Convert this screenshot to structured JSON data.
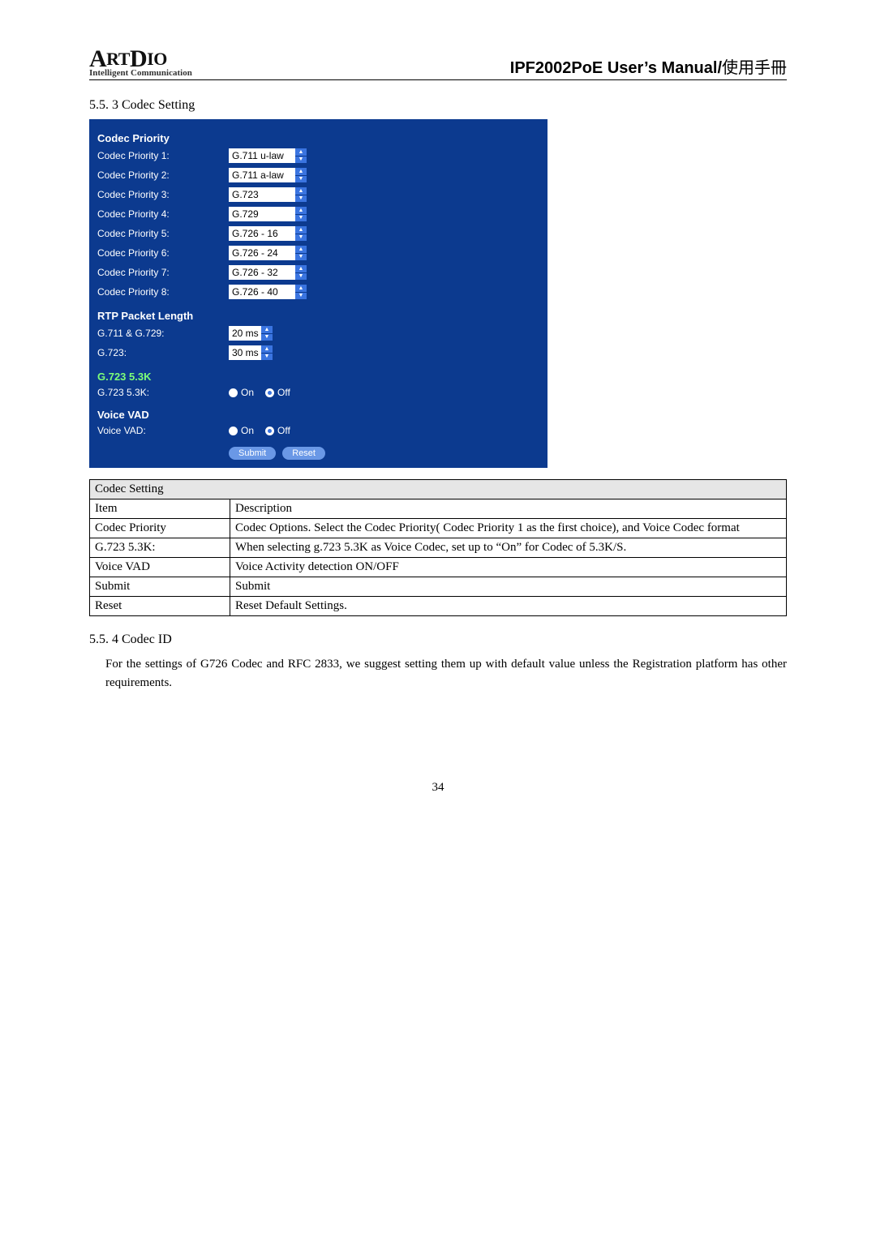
{
  "header": {
    "logo_top_a": "A",
    "logo_top_rt": "RT",
    "logo_top_d": "D",
    "logo_top_io": "IO",
    "logo_sub": "Intelligent Communication",
    "title_bold": "IPF2002PoE User’s Manual",
    "title_sep": "/",
    "title_cjk": "使用手冊"
  },
  "section_codec_setting": "5.5. 3 Codec Setting",
  "panel": {
    "codec_priority_title": "Codec Priority",
    "rows": [
      {
        "label": "Codec Priority 1:",
        "value": "G.711 u-law"
      },
      {
        "label": "Codec Priority 2:",
        "value": "G.711 a-law"
      },
      {
        "label": "Codec Priority 3:",
        "value": "G.723"
      },
      {
        "label": "Codec Priority 4:",
        "value": "G.729"
      },
      {
        "label": "Codec Priority 5:",
        "value": "G.726 - 16"
      },
      {
        "label": "Codec Priority 6:",
        "value": "G.726 - 24"
      },
      {
        "label": "Codec Priority 7:",
        "value": "G.726 - 32"
      },
      {
        "label": "Codec Priority 8:",
        "value": "G.726 - 40"
      }
    ],
    "rtp_title": "RTP Packet Length",
    "rtp_rows": [
      {
        "label": "G.711 & G.729:",
        "value": "20 ms"
      },
      {
        "label": "G.723:",
        "value": "30 ms"
      }
    ],
    "g723_title": "G.723 5.3K",
    "g723_row_label": "G.723 5.3K:",
    "voice_vad_title": "Voice VAD",
    "voice_vad_row_label": "Voice VAD:",
    "on_label": "On",
    "off_label": "Off",
    "submit_label": "Submit",
    "reset_label": "Reset"
  },
  "table": {
    "head": "Codec Setting",
    "item_label": "Item",
    "desc_label": "Description",
    "rows": [
      {
        "item": "Codec Priority",
        "desc": "Codec Options. Select the Codec Priority( Codec Priority 1 as the first choice), and Voice Codec format"
      },
      {
        "item": "G.723 5.3K:",
        "desc": "When selecting g.723 5.3K as Voice Codec, set up to “On” for Codec of 5.3K/S."
      },
      {
        "item": "Voice VAD",
        "desc": "Voice Activity detection ON/OFF"
      },
      {
        "item": "Submit",
        "desc": "Submit"
      },
      {
        "item": "Reset",
        "desc": "Reset Default Settings."
      }
    ]
  },
  "section_codec_id": "5.5. 4 Codec ID",
  "para_codec_id": "For the settings of G726 Codec and RFC 2833, we suggest setting them up with default value unless the Registration platform has other requirements.",
  "page_number": "34"
}
